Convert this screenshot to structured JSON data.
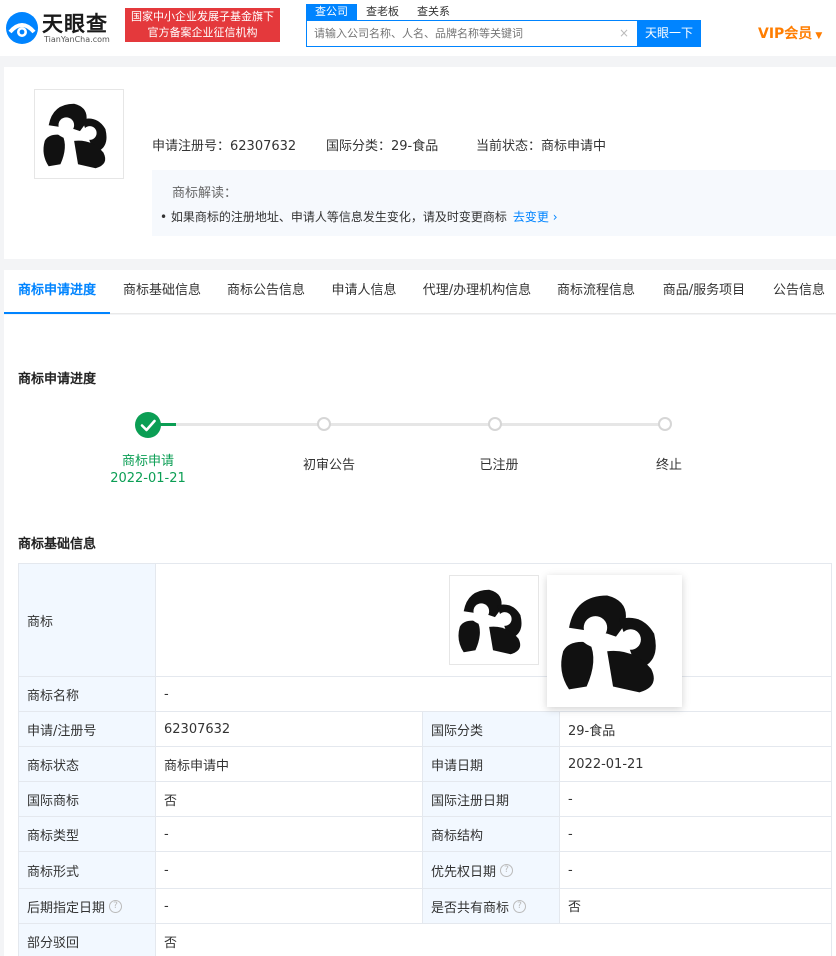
{
  "header": {
    "logo_text": "天眼查",
    "logo_sub": "TianYanCha.com",
    "badge_line1": "国家中小企业发展子基金旗下",
    "badge_line2": "官方备案企业征信机构",
    "search_tabs": [
      "查公司",
      "查老板",
      "查关系"
    ],
    "search_placeholder": "请输入公司名称、人名、品牌名称等关键词",
    "search_clear": "×",
    "search_button": "天眼一下",
    "vip_label": "VIP会员"
  },
  "summary": {
    "reg_no": "申请注册号：62307632",
    "intl_class": "国际分类：29-食品",
    "status": "当前状态：商标申请中",
    "interp_title": "商标解读：",
    "interp_text": "• 如果商标的注册地址、申请人等信息发生变化，请及时变更商标",
    "interp_link": "去变更"
  },
  "tabs": [
    "商标申请进度",
    "商标基础信息",
    "商标公告信息",
    "申请人信息",
    "代理/办理机构信息",
    "商标流程信息",
    "商品/服务项目",
    "公告信息"
  ],
  "progress": {
    "title": "商标申请进度",
    "steps": [
      {
        "label": "商标申请",
        "date": "2022-01-21",
        "done": true
      },
      {
        "label": "初审公告",
        "date": "",
        "done": false
      },
      {
        "label": "已注册",
        "date": "",
        "done": false
      },
      {
        "label": "终止",
        "date": "",
        "done": false
      }
    ]
  },
  "basic": {
    "title": "商标基础信息",
    "rows": [
      {
        "l1": "商标",
        "v1": ""
      },
      {
        "l1": "商标名称",
        "v1": "-"
      },
      {
        "l1": "申请/注册号",
        "v1": "62307632",
        "l2": "国际分类",
        "v2": "29-食品"
      },
      {
        "l1": "商标状态",
        "v1": "商标申请中",
        "l2": "申请日期",
        "v2": "2022-01-21"
      },
      {
        "l1": "国际商标",
        "v1": "否",
        "l2": "国际注册日期",
        "v2": "-"
      },
      {
        "l1": "商标类型",
        "v1": "-",
        "l2": "商标结构",
        "v2": "-"
      },
      {
        "l1": "商标形式",
        "v1": "-",
        "l2": "优先权日期",
        "v2": "-"
      },
      {
        "l1": "后期指定日期",
        "v1": "-",
        "l2": "是否共有商标",
        "v2": "否"
      },
      {
        "l1": "部分驳回",
        "v1": "否"
      }
    ]
  },
  "help_glyph": "?",
  "chevron": "›"
}
